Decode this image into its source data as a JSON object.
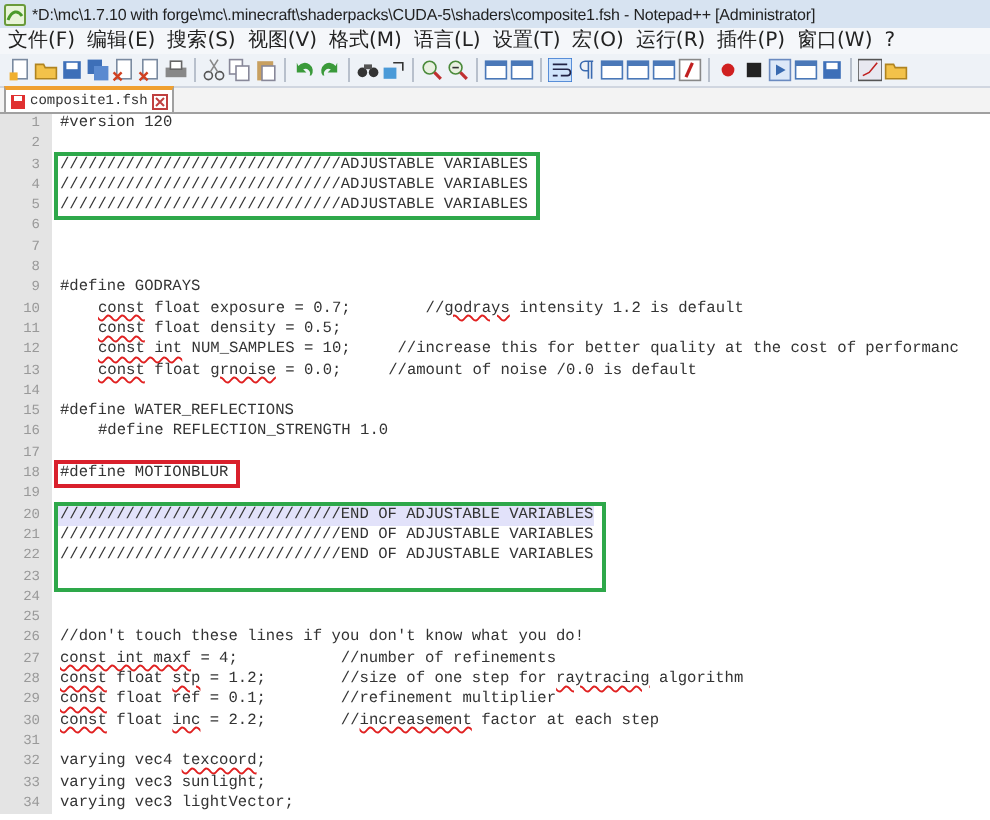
{
  "window": {
    "title": "*D:\\mc\\1.7.10 with forge\\mc\\.minecraft\\shaderpacks\\CUDA-5\\shaders\\composite1.fsh - Notepad++ [Administrator]"
  },
  "menu": [
    "文件(F)",
    "编辑(E)",
    "搜索(S)",
    "视图(V)",
    "格式(M)",
    "语言(L)",
    "设置(T)",
    "宏(O)",
    "运行(R)",
    "插件(P)",
    "窗口(W)",
    "?"
  ],
  "tabs": [
    {
      "label": "composite1.fsh",
      "selected": true,
      "modified": true
    }
  ],
  "editor": {
    "lines": [
      {
        "kind": "line",
        "number": "1",
        "current": false,
        "indented": false,
        "parts": [
          {
            "text": "#version 120",
            "misspelled": false
          }
        ]
      },
      {
        "kind": "line",
        "number": "2",
        "current": false
      },
      {
        "kind": "box",
        "color": "#2ea84a",
        "lines": [
          {
            "kind": "line",
            "number": "3",
            "current": false,
            "indented": false,
            "parts": [
              {
                "text": "//////////////////////////////ADJUSTABLE VARIABLES",
                "misspelled": false
              }
            ]
          },
          {
            "kind": "line",
            "number": "4",
            "current": false,
            "indented": false,
            "parts": [
              {
                "text": "//////////////////////////////ADJUSTABLE VARIABLES",
                "misspelled": false
              }
            ]
          },
          {
            "kind": "line",
            "number": "5",
            "current": false,
            "indented": false,
            "parts": [
              {
                "text": "//////////////////////////////ADJUSTABLE VARIABLES",
                "misspelled": false
              }
            ]
          }
        ]
      },
      {
        "kind": "line",
        "number": "6",
        "current": false
      },
      {
        "kind": "line",
        "number": "7",
        "current": false
      },
      {
        "kind": "line",
        "number": "8",
        "current": false
      },
      {
        "kind": "line",
        "number": "9",
        "current": false,
        "indented": false,
        "parts": [
          {
            "text": "#define GODRAYS",
            "misspelled": false
          }
        ]
      },
      {
        "kind": "line",
        "number": "10",
        "current": false,
        "indented": true,
        "parts": [
          {
            "text": "const",
            "misspelled": true
          },
          {
            "text": " float exposure = 0.7;        //",
            "misspelled": false
          },
          {
            "text": "godrays",
            "misspelled": true
          },
          {
            "text": " intensity 1.2 is default",
            "misspelled": false
          }
        ]
      },
      {
        "kind": "line",
        "number": "11",
        "current": false,
        "indented": true,
        "parts": [
          {
            "text": "const",
            "misspelled": true
          },
          {
            "text": " float density = 0.5;",
            "misspelled": false
          }
        ]
      },
      {
        "kind": "line",
        "number": "12",
        "current": false,
        "indented": true,
        "parts": [
          {
            "text": "const int",
            "misspelled": true
          },
          {
            "text": " NUM_SAMPLES = 10;     //increase this for better quality at the cost of performanc",
            "misspelled": false
          }
        ]
      },
      {
        "kind": "line",
        "number": "13",
        "current": false,
        "indented": true,
        "parts": [
          {
            "text": "const",
            "misspelled": true
          },
          {
            "text": " float ",
            "misspelled": false
          },
          {
            "text": "grnoise",
            "misspelled": true
          },
          {
            "text": " = 0.0;     //amount of noise /0.0 is default",
            "misspelled": false
          }
        ]
      },
      {
        "kind": "line",
        "number": "14",
        "current": false
      },
      {
        "kind": "line",
        "number": "15",
        "current": false,
        "indented": false,
        "parts": [
          {
            "text": "#define WATER_REFLECTIONS",
            "misspelled": false
          }
        ]
      },
      {
        "kind": "line",
        "number": "16",
        "current": false,
        "indented": true,
        "parts": [
          {
            "text": "#define REFLECTION_STRENGTH 1.0",
            "misspelled": false
          }
        ]
      },
      {
        "kind": "line",
        "number": "17",
        "current": false
      },
      {
        "kind": "box",
        "color": "#d9202c",
        "lines": [
          {
            "kind": "line",
            "number": "18",
            "current": false,
            "indented": false,
            "parts": [
              {
                "text": "#define MOTIONBLUR",
                "misspelled": false
              }
            ]
          }
        ]
      },
      {
        "kind": "line",
        "number": "19",
        "current": false
      },
      {
        "kind": "box",
        "color": "#2ea84a",
        "lines": [
          {
            "kind": "line",
            "number": "20",
            "current": true,
            "indented": false,
            "parts": [
              {
                "text": "//////////////////////////////END OF ADJUSTABLE VARIABLES",
                "misspelled": false
              }
            ]
          },
          {
            "kind": "line",
            "number": "21",
            "current": false,
            "indented": false,
            "parts": [
              {
                "text": "//////////////////////////////END OF ADJUSTABLE VARIABLES",
                "misspelled": false
              }
            ]
          },
          {
            "kind": "line",
            "number": "22",
            "current": false,
            "indented": false,
            "parts": [
              {
                "text": "//////////////////////////////END OF ADJUSTABLE VARIABLES",
                "misspelled": false
              }
            ]
          },
          {
            "kind": "line",
            "number": "23",
            "current": false
          }
        ]
      },
      {
        "kind": "line",
        "number": "24",
        "current": false
      },
      {
        "kind": "line",
        "number": "25",
        "current": false
      },
      {
        "kind": "line",
        "number": "26",
        "current": false,
        "indented": false,
        "parts": [
          {
            "text": "//don't touch these lines if you don't know what you do!",
            "misspelled": false
          }
        ]
      },
      {
        "kind": "line",
        "number": "27",
        "current": false,
        "indented": false,
        "parts": [
          {
            "text": "const int maxf",
            "misspelled": true
          },
          {
            "text": " = 4;           //number of refinements",
            "misspelled": false
          }
        ]
      },
      {
        "kind": "line",
        "number": "28",
        "current": false,
        "indented": false,
        "parts": [
          {
            "text": "const",
            "misspelled": true
          },
          {
            "text": " float ",
            "misspelled": false
          },
          {
            "text": "stp",
            "misspelled": true
          },
          {
            "text": " = 1.2;        //size of one step for ",
            "misspelled": false
          },
          {
            "text": "raytracing",
            "misspelled": true
          },
          {
            "text": " algorithm",
            "misspelled": false
          }
        ]
      },
      {
        "kind": "line",
        "number": "29",
        "current": false,
        "indented": false,
        "parts": [
          {
            "text": "const",
            "misspelled": true
          },
          {
            "text": " float ref = 0.1;        //refinement multiplier",
            "misspelled": false
          }
        ]
      },
      {
        "kind": "line",
        "number": "30",
        "current": false,
        "indented": false,
        "parts": [
          {
            "text": "const",
            "misspelled": true
          },
          {
            "text": " float ",
            "misspelled": false
          },
          {
            "text": "inc",
            "misspelled": true
          },
          {
            "text": " = 2.2;        //",
            "misspelled": false
          },
          {
            "text": "increasement",
            "misspelled": true
          },
          {
            "text": " factor at each step",
            "misspelled": false
          }
        ]
      },
      {
        "kind": "line",
        "number": "31",
        "current": false
      },
      {
        "kind": "line",
        "number": "32",
        "current": false,
        "indented": false,
        "parts": [
          {
            "text": "varying vec4 ",
            "misspelled": false
          },
          {
            "text": "texcoord",
            "misspelled": true
          },
          {
            "text": ";",
            "misspelled": false
          }
        ]
      },
      {
        "kind": "line",
        "number": "33",
        "current": false,
        "indented": false,
        "parts": [
          {
            "text": "varying vec3 sunlight;",
            "misspelled": false
          }
        ]
      },
      {
        "kind": "line",
        "number": "34",
        "current": false,
        "indented": false,
        "parts": [
          {
            "text": "varying vec3 lightVector;",
            "misspelled": false
          }
        ]
      }
    ]
  }
}
